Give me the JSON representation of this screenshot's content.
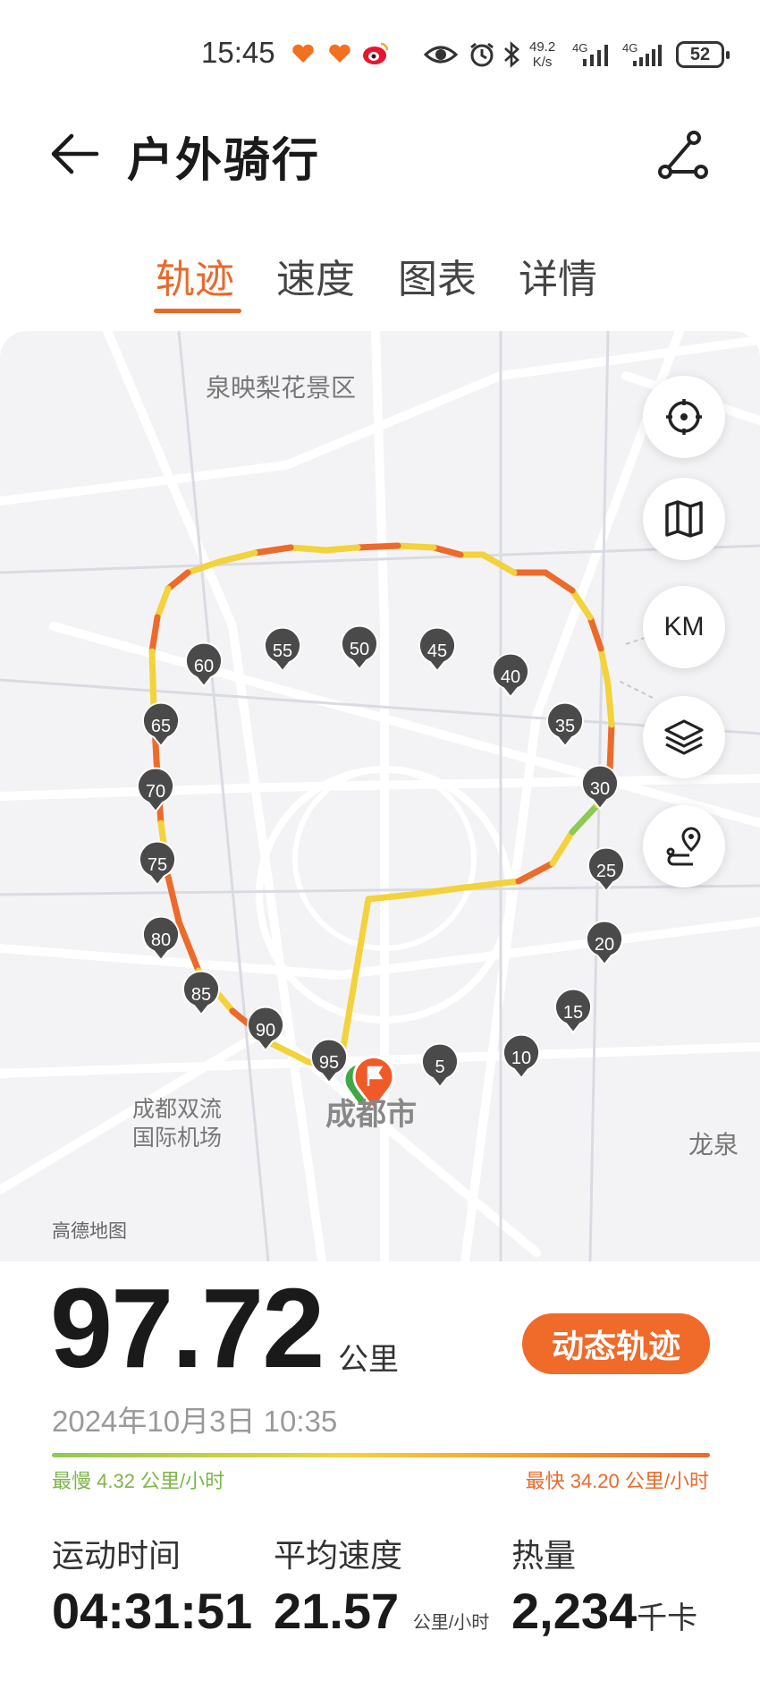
{
  "status_bar": {
    "time": "15:45",
    "net_speed_value": "49.2",
    "net_speed_unit": "K/s",
    "net1": "4G",
    "net2": "4G",
    "battery": "52"
  },
  "header": {
    "title": "户外骑行",
    "back_icon": "arrow-left-icon",
    "share_icon": "share-icon"
  },
  "tabs": [
    {
      "label": "轨迹",
      "active": true
    },
    {
      "label": "速度",
      "active": false
    },
    {
      "label": "图表",
      "active": false
    },
    {
      "label": "详情",
      "active": false
    }
  ],
  "map": {
    "labels": {
      "scenic": "泉映梨花景区",
      "airport_line1": "成都双流",
      "airport_line2": "国际机场",
      "city": "成都市",
      "east": "龙泉"
    },
    "km_markers": [
      "5",
      "10",
      "15",
      "20",
      "25",
      "30",
      "35",
      "40",
      "45",
      "50",
      "55",
      "60",
      "65",
      "70",
      "75",
      "80",
      "85",
      "90",
      "95"
    ],
    "controls": {
      "locate": "locate-icon",
      "map_style": "map-icon",
      "km_toggle": "KM",
      "layers": "layers-icon",
      "route": "route-icon"
    },
    "provider": "高德地图",
    "colors": {
      "slow": "#8ccb52",
      "mid": "#f3d23b",
      "fast": "#ed6a2a"
    }
  },
  "summary": {
    "distance": "97.72",
    "distance_unit": "公里",
    "dynamic_track_button": "动态轨迹",
    "date": "2024年10月3日 10:35",
    "slowest": "最慢 4.32 公里/小时",
    "fastest": "最快 34.20 公里/小时"
  },
  "stats": [
    {
      "label": "运动时间",
      "value": "04:31:51",
      "unit": ""
    },
    {
      "label": "平均速度",
      "value": "21.57",
      "unit": "公里/小时"
    },
    {
      "label": "热量",
      "value": "2,234",
      "unit": "千卡"
    }
  ]
}
